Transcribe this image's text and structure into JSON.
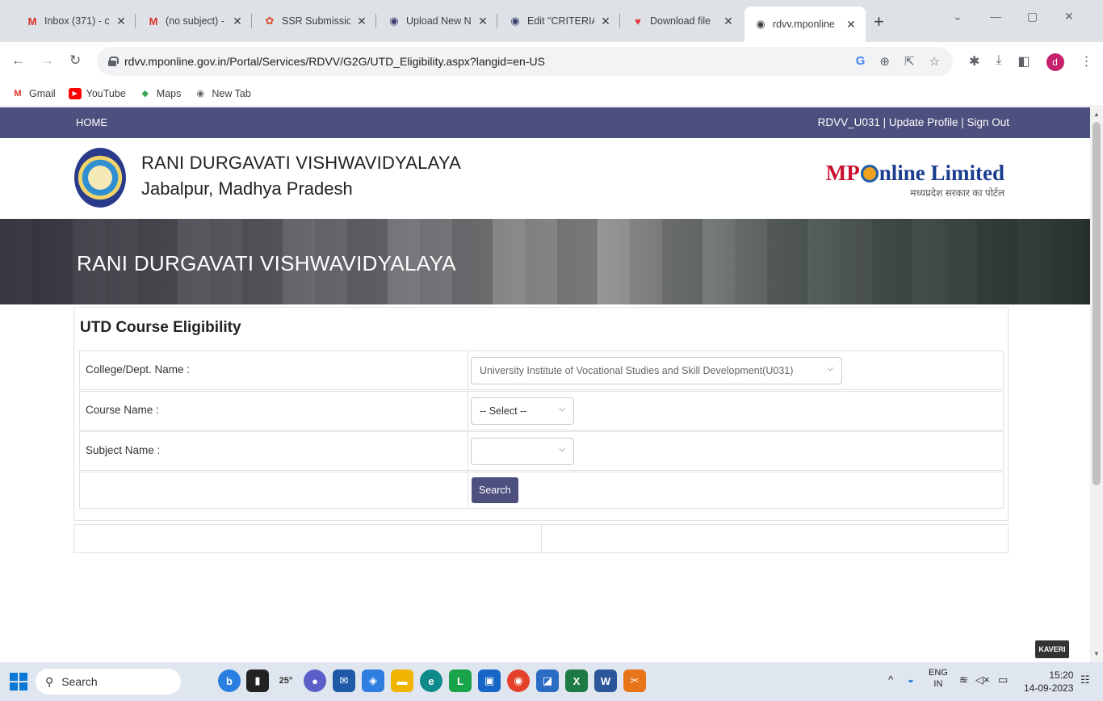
{
  "browser": {
    "tabs": [
      {
        "label": "Inbox (371) - c",
        "icon": "gmail-icon"
      },
      {
        "label": "(no subject) -",
        "icon": "gmail-icon"
      },
      {
        "label": "SSR Submissio",
        "icon": "ssr-icon"
      },
      {
        "label": "Upload New N",
        "icon": "globe-icon"
      },
      {
        "label": "Edit \"CRITERIA",
        "icon": "globe-icon"
      },
      {
        "label": "Download file",
        "icon": "heart-icon"
      },
      {
        "label": "rdvv.mponline",
        "icon": "globe-icon"
      }
    ],
    "url": "rdvv.mponline.gov.in/Portal/Services/RDVV/G2G/UTD_Eligibility.aspx?langid=en-US",
    "bookmarks": [
      {
        "label": "Gmail"
      },
      {
        "label": "YouTube"
      },
      {
        "label": "Maps"
      },
      {
        "label": "New Tab"
      }
    ],
    "profile_initial": "d"
  },
  "page": {
    "nav": {
      "home": "HOME",
      "account": "RDVV_U031 | Update Profile | Sign Out"
    },
    "university": {
      "name": "RANI DURGAVATI VISHWAVIDYALAYA",
      "location": "Jabalpur, Madhya Pradesh"
    },
    "mponline": {
      "mp": "MP",
      "rest": "nline Limited",
      "tagline": "मध्यप्रदेश सरकार का पोर्टल"
    },
    "banner_title": "RANI DURGAVATI VISHWAVIDYALAYA",
    "form": {
      "title": "UTD Course Eligibility",
      "college_label": "College/Dept. Name :",
      "college_value": "University Institute of Vocational Studies and Skill Development(U031)",
      "course_label": "Course Name  :",
      "course_value": "-- Select --",
      "subject_label": "Subject Name :",
      "subject_value": "",
      "search_label": "Search"
    },
    "badge": "KAVERI"
  },
  "taskbar": {
    "search": "Search",
    "weather": "25°",
    "lang": "ENG",
    "region": "IN",
    "time": "15:20",
    "date": "14-09-2023"
  },
  "colors": {
    "nav_bg": "#4d4f7e",
    "button_bg": "#4d4f7e",
    "mp_red": "#c8102e",
    "mp_blue": "#1a3d8f"
  }
}
